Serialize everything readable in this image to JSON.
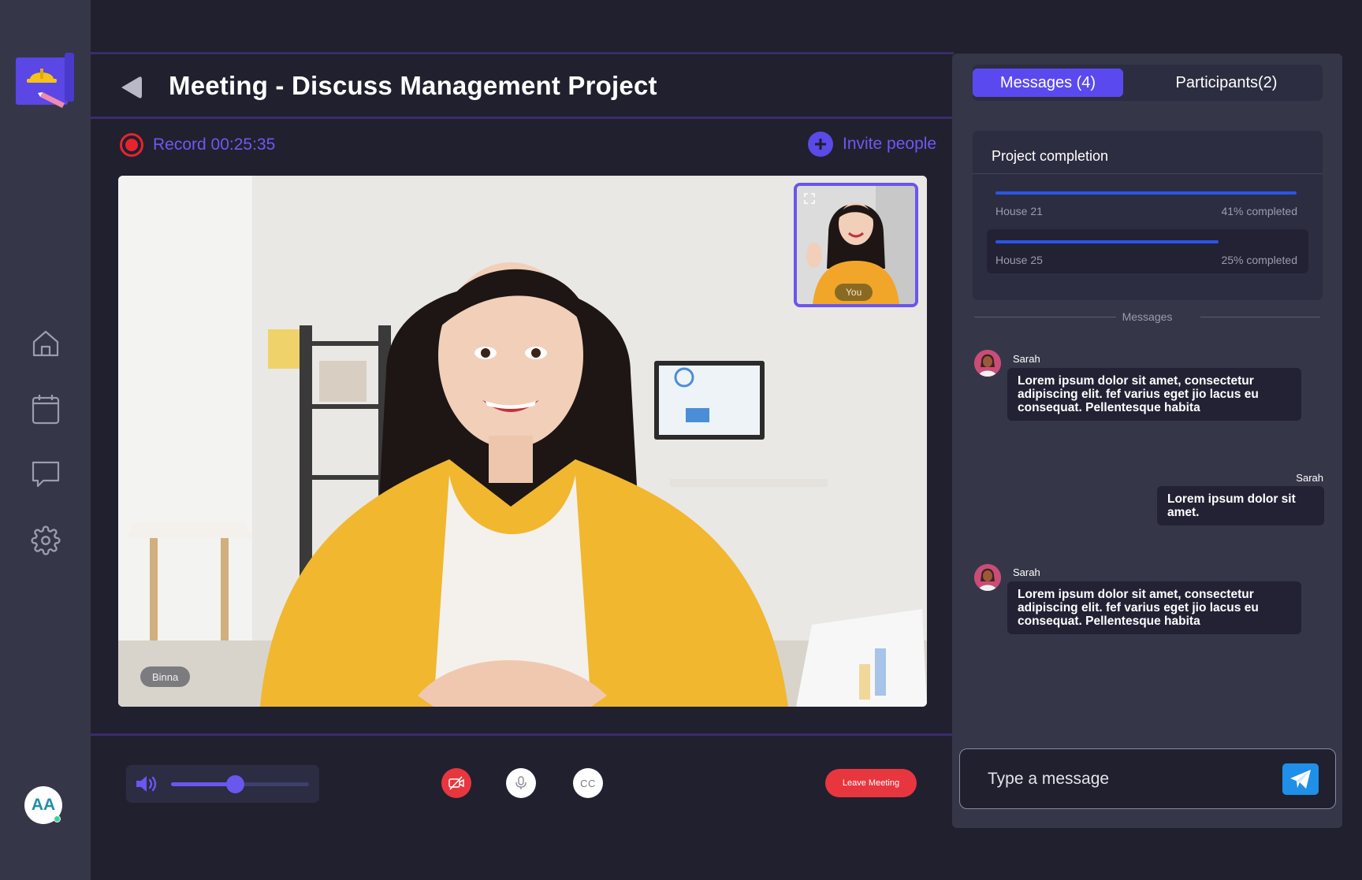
{
  "meeting": {
    "title": "Meeting - Discuss Management Project",
    "record_label": "Record 00:25:35",
    "invite_label": "Invite people"
  },
  "video": {
    "main_participant": "Binna",
    "self_label": "You"
  },
  "controls": {
    "volume_level": 0.46,
    "leave_label": "Leave Meeting",
    "cc_label": "CC"
  },
  "panel": {
    "tabs": [
      {
        "label": "Messages (4)",
        "active": true
      },
      {
        "label": "Participants(2)",
        "active": false
      }
    ],
    "progress": {
      "title": "Project completion",
      "items": [
        {
          "name": "House 21",
          "value_label": "41% completed",
          "fraction": 1.0
        },
        {
          "name": "House 25",
          "value_label": "25% completed",
          "fraction": 0.74
        }
      ]
    },
    "messages_divider": "Messages",
    "messages": [
      {
        "sender": "Sarah",
        "text": "Lorem ipsum dolor sit amet, consectetur adipiscing elit. fef varius eget jio lacus eu consequat. Pellentesque habita",
        "outgoing": false
      },
      {
        "sender": "Sarah",
        "text": "Lorem ipsum dolor sit amet.",
        "outgoing": true
      },
      {
        "sender": "Sarah",
        "text": "Lorem ipsum dolor sit amet, consectetur adipiscing elit. fef varius eget jio lacus eu consequat. Pellentesque habita",
        "outgoing": false
      }
    ],
    "composer_placeholder": "Type a message"
  },
  "user": {
    "initials": "AA"
  },
  "colors": {
    "accent": "#5b49f0",
    "danger": "#e8363f",
    "progress": "#2a55e8",
    "send": "#1f8fe8"
  },
  "icons": {
    "sidebar": [
      "home-icon",
      "calendar-icon",
      "chat-icon",
      "settings-icon"
    ],
    "controls": [
      "camera-off-icon",
      "microphone-icon",
      "closed-captions-icon",
      "volume-icon",
      "send-icon"
    ]
  }
}
